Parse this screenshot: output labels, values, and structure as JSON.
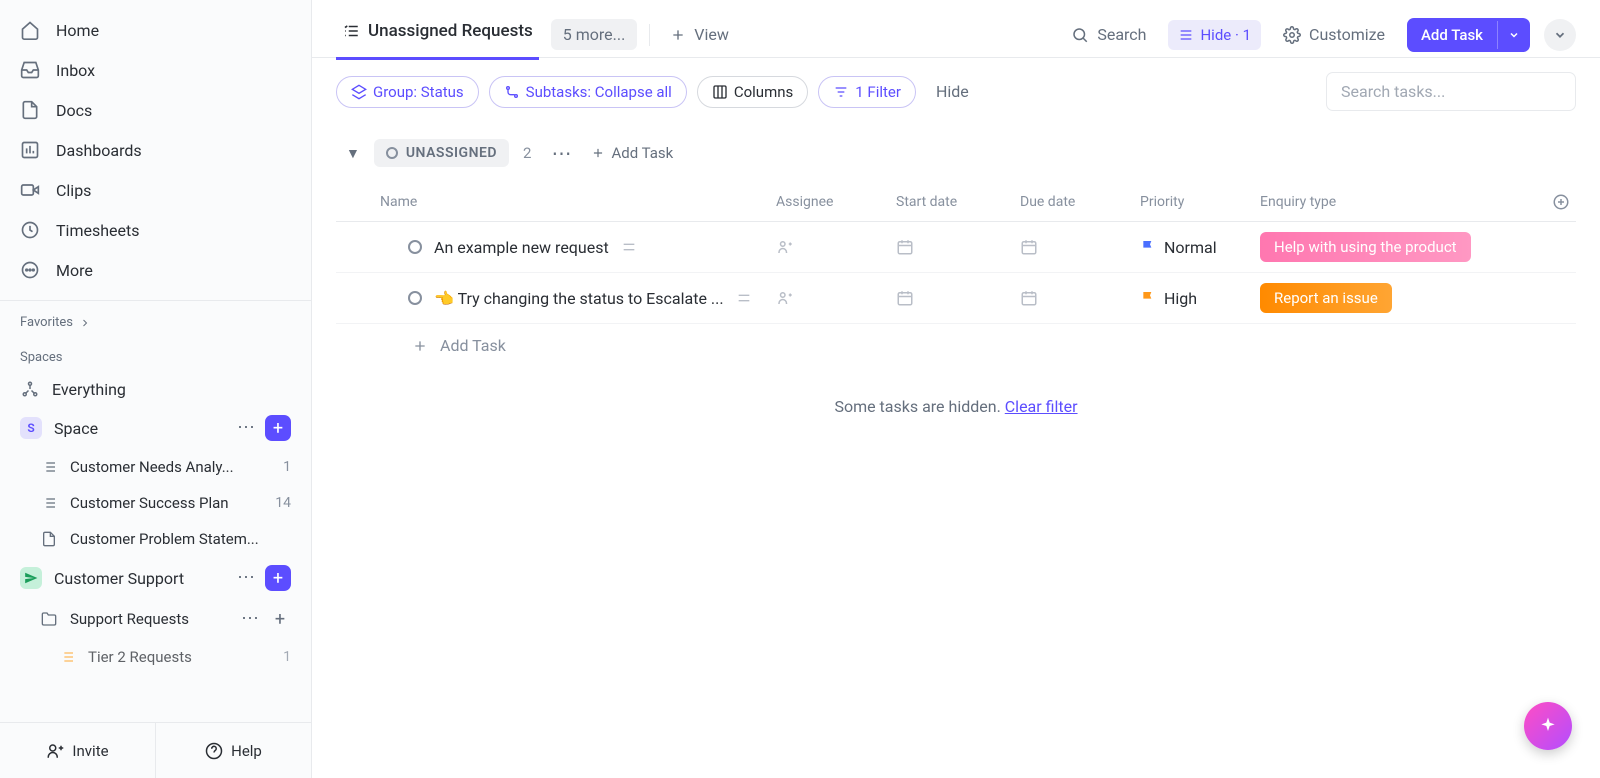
{
  "nav": [
    {
      "label": "Home"
    },
    {
      "label": "Inbox"
    },
    {
      "label": "Docs"
    },
    {
      "label": "Dashboards"
    },
    {
      "label": "Clips"
    },
    {
      "label": "Timesheets"
    },
    {
      "label": "More"
    }
  ],
  "sections": {
    "favorites": "Favorites",
    "spaces": "Spaces"
  },
  "spaces": {
    "everything": "Everything",
    "space": {
      "label": "Space",
      "badge": "S",
      "items": [
        {
          "label": "Customer Needs Analy...",
          "count": "1"
        },
        {
          "label": "Customer Success Plan",
          "count": "14"
        },
        {
          "label": "Customer Problem Statem..."
        }
      ]
    },
    "support": {
      "label": "Customer Support",
      "items": [
        {
          "label": "Support Requests"
        },
        {
          "label": "Tier 2 Requests",
          "count": "1"
        }
      ]
    }
  },
  "footer": {
    "invite": "Invite",
    "help": "Help"
  },
  "topbar": {
    "tab_active": "Unassigned Requests",
    "more": "5 more...",
    "view": "View",
    "search": "Search",
    "hide": "Hide · 1",
    "customize": "Customize",
    "add_task": "Add Task"
  },
  "toolbar": {
    "group": "Group: Status",
    "subtasks": "Subtasks: Collapse all",
    "columns": "Columns",
    "filter": "1 Filter",
    "hide": "Hide",
    "search_placeholder": "Search tasks..."
  },
  "group": {
    "status": "UNASSIGNED",
    "count": "2",
    "add": "Add Task"
  },
  "columns": {
    "name": "Name",
    "assignee": "Assignee",
    "start": "Start date",
    "due": "Due date",
    "priority": "Priority",
    "enq": "Enquiry type"
  },
  "tasks": [
    {
      "title": "An example new request",
      "priority": "Normal",
      "tag": "Help with using the product",
      "flag": "blue"
    },
    {
      "title": "👈 Try changing the status to Escalate ...",
      "priority": "High",
      "tag": "Report an issue",
      "flag": "orange"
    }
  ],
  "add_task_row": "Add Task",
  "hidden": {
    "text": "Some tasks are hidden. ",
    "link": "Clear filter"
  }
}
